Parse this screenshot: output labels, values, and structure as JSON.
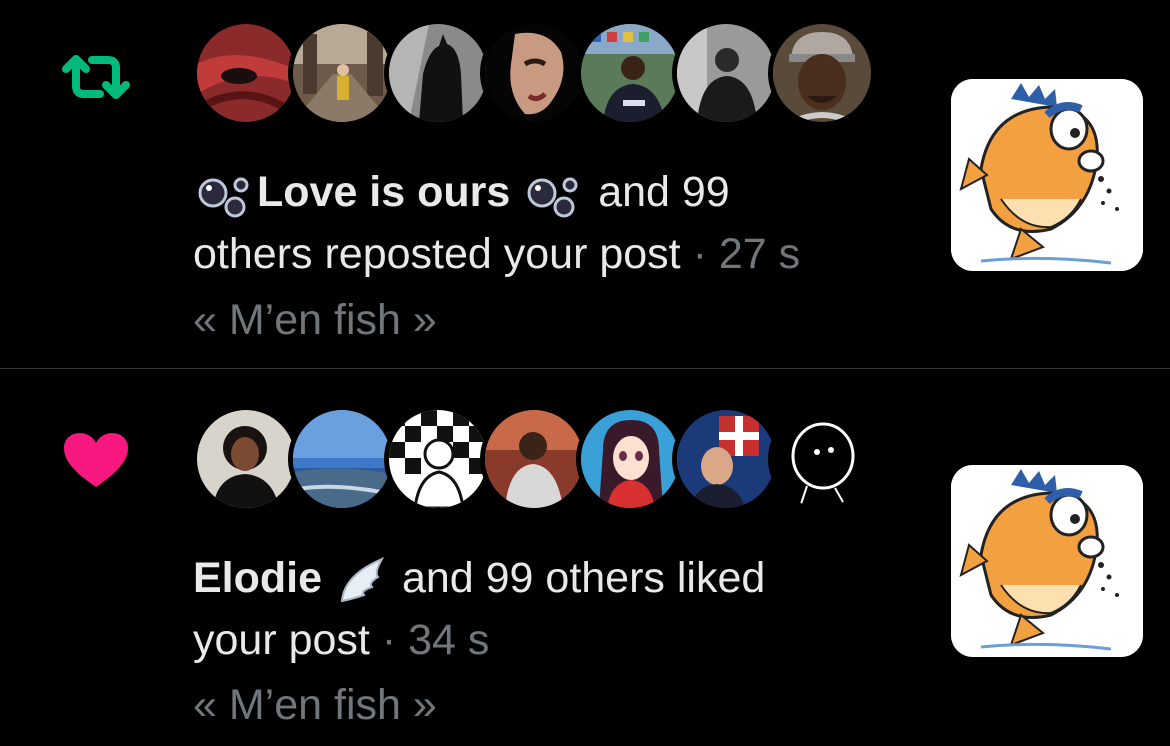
{
  "notifications": [
    {
      "type": "repost",
      "icon": "repost-icon",
      "icon_color": "#00ba7c",
      "actor_name": "Love is ours",
      "actor_emoji": "bubbles-emoji",
      "rest_line1": "and 99",
      "rest_line2": "others reposted your post",
      "separator": "·",
      "time": "27 s",
      "post_title": "« M’en fish »"
    },
    {
      "type": "like",
      "icon": "heart-icon",
      "icon_color": "#f91880",
      "actor_name": "Elodie",
      "actor_emoji": "wing-emoji",
      "rest_line1": "and 99 others liked",
      "rest_line2": "your post",
      "separator": "·",
      "time": "34 s",
      "post_title": "« M’en fish »"
    }
  ],
  "colors": {
    "background": "#000000",
    "text": "#e7e9ea",
    "secondary": "#71767b",
    "divider": "#2f3336"
  }
}
